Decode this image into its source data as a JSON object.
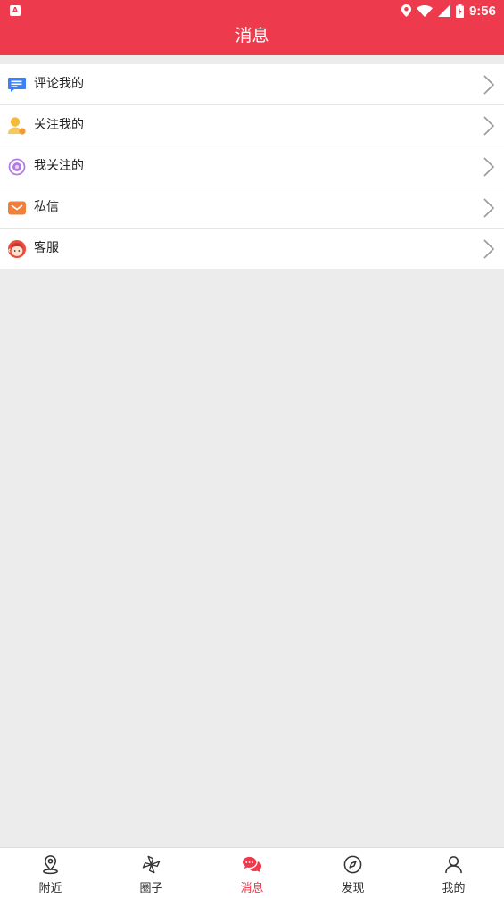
{
  "status_bar": {
    "app_badge": "A",
    "time": "9:56",
    "icons": [
      "location-icon",
      "wifi-icon",
      "signal-icon",
      "battery-icon"
    ]
  },
  "header": {
    "title": "消息"
  },
  "menu": {
    "items": [
      {
        "label": "评论我的",
        "icon": "comment-icon"
      },
      {
        "label": "关注我的",
        "icon": "follower-icon"
      },
      {
        "label": "我关注的",
        "icon": "following-icon"
      },
      {
        "label": "私信",
        "icon": "mail-icon"
      },
      {
        "label": "客服",
        "icon": "customer-service-icon"
      }
    ]
  },
  "tabs": [
    {
      "label": "附近",
      "icon": "location-pin-icon",
      "active": false
    },
    {
      "label": "圈子",
      "icon": "pinwheel-icon",
      "active": false
    },
    {
      "label": "消息",
      "icon": "chat-bubbles-icon",
      "active": true
    },
    {
      "label": "发现",
      "icon": "compass-icon",
      "active": false
    },
    {
      "label": "我的",
      "icon": "person-icon",
      "active": false
    }
  ],
  "colors": {
    "accent": "#ee3a4d",
    "background": "#ececec"
  }
}
